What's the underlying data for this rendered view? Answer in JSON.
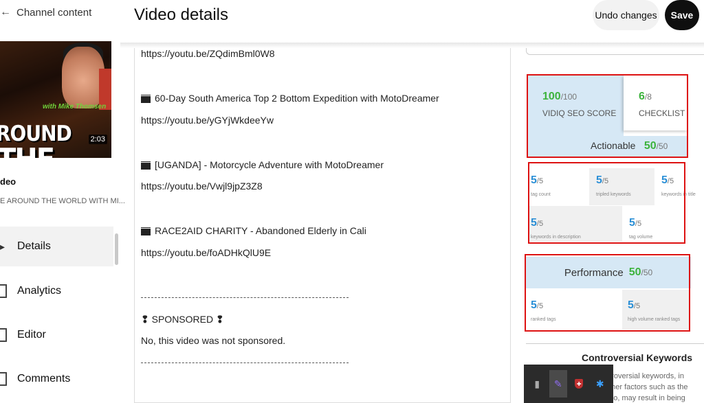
{
  "sidebar": {
    "back_label": "Channel content",
    "thumbnail": {
      "line1": "ROUND",
      "line2": "THE WORLD",
      "subtitle": "with Mike Thomsen",
      "duration": "2:03"
    },
    "video_label": "deo",
    "video_title": "E AROUND THE WORLD WITH MI...",
    "nav": [
      {
        "label": "Details",
        "active": true
      },
      {
        "label": "Analytics"
      },
      {
        "label": "Editor"
      },
      {
        "label": "Comments"
      }
    ]
  },
  "header": {
    "title": "Video details",
    "undo_label": "Undo changes",
    "save_label": "Save"
  },
  "description": {
    "lines": [
      "https://youtu.be/ZQdimBml0W8",
      "60-Day South America Top 2 Bottom Expedition with MotoDreamer",
      "https://youtu.be/yGYjWkdeeYw",
      "[UGANDA] - Motorcycle Adventure with MotoDreamer",
      "https://youtu.be/Vwjl9jpZ3Z8",
      "RACE2AID CHARITY - Abandoned Elderly in Cali",
      "https://youtu.be/foADHkQlU9E",
      "SPONSORED",
      "No, this video was not sponsored."
    ]
  },
  "seo": {
    "score_value": "100",
    "score_den": "/100",
    "score_label": "VIDIQ SEO SCORE",
    "checklist_value": "6",
    "checklist_den": "/8",
    "checklist_label": "CHECKLIST",
    "actionable_label": "Actionable",
    "actionable_value": "50",
    "actionable_den": "/50",
    "metrics": [
      {
        "value": "5",
        "den": "/5",
        "label": "tag count"
      },
      {
        "value": "5",
        "den": "/5",
        "label": "tripled keywords"
      },
      {
        "value": "5",
        "den": "/5",
        "label": "keywords in title"
      },
      {
        "value": "5",
        "den": "/5",
        "label": "keywords in description"
      },
      {
        "value": "5",
        "den": "/5",
        "label": "tag volume"
      }
    ],
    "performance_label": "Performance",
    "performance_value": "50",
    "performance_den": "/50",
    "perf_metrics": [
      {
        "value": "5",
        "den": "/5",
        "label": "ranked tags"
      },
      {
        "value": "5",
        "den": "/5",
        "label": "high volume ranked tags"
      }
    ],
    "controversial_title": "Controversial Keywords",
    "controversial_text": "ntroversial keywords, in other factors such as the deo, may result in being"
  },
  "colors": {
    "score_green": "#3db33d",
    "metric_blue": "#2a8fd6",
    "panel_blue": "#d6e8f5",
    "highlight_red": "#d11111"
  },
  "tray": {
    "icons": [
      "camera-icon",
      "pen-icon",
      "shield-icon",
      "bluetooth-icon"
    ]
  }
}
